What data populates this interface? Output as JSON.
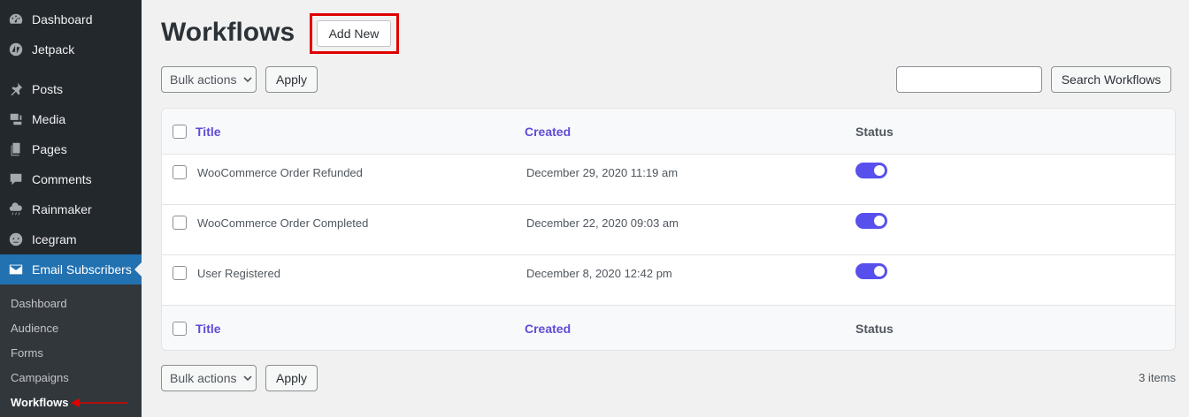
{
  "sidebar": {
    "items": [
      {
        "label": "Dashboard",
        "icon": "dashboard-icon"
      },
      {
        "label": "Jetpack",
        "icon": "jetpack-icon"
      },
      {
        "label": "Posts",
        "icon": "pin-icon"
      },
      {
        "label": "Media",
        "icon": "media-icon"
      },
      {
        "label": "Pages",
        "icon": "pages-icon"
      },
      {
        "label": "Comments",
        "icon": "comment-icon"
      },
      {
        "label": "Rainmaker",
        "icon": "cloud-icon"
      },
      {
        "label": "Icegram",
        "icon": "icegram-icon"
      },
      {
        "label": "Email Subscribers",
        "icon": "envelope-icon"
      }
    ],
    "submenu": [
      {
        "label": "Dashboard"
      },
      {
        "label": "Audience"
      },
      {
        "label": "Forms"
      },
      {
        "label": "Campaigns"
      },
      {
        "label": "Workflows"
      }
    ]
  },
  "page": {
    "title": "Workflows",
    "add_new_label": "Add New"
  },
  "toolbar": {
    "bulk_actions_label": "Bulk actions",
    "apply_label": "Apply",
    "search_value": "",
    "search_button_label": "Search Workflows"
  },
  "table": {
    "columns": {
      "title": "Title",
      "created": "Created",
      "status": "Status"
    },
    "rows": [
      {
        "title": "WooCommerce Order Refunded",
        "created": "December 29, 2020 11:19 am",
        "status": "on"
      },
      {
        "title": "WooCommerce Order Completed",
        "created": "December 22, 2020 09:03 am",
        "status": "on"
      },
      {
        "title": "User Registered",
        "created": "December 8, 2020 12:42 pm",
        "status": "on"
      }
    ]
  },
  "footer": {
    "bulk_actions_label": "Bulk actions",
    "apply_label": "Apply",
    "items_count": "3 items"
  },
  "colors": {
    "sidebar_bg": "#23282d",
    "active_blue": "#2271b1",
    "accent_purple": "#5f4bd6",
    "toggle_on": "#5850ec",
    "highlight_red": "#e00000"
  }
}
